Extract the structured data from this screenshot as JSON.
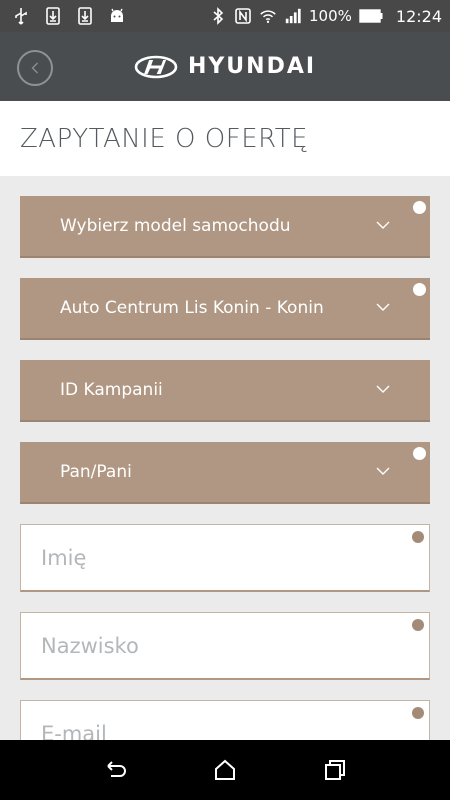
{
  "status_bar": {
    "battery": "100%",
    "time": "12:24",
    "icons": [
      "usb-icon",
      "download-icon",
      "download-icon",
      "android-icon",
      "bluetooth-icon",
      "nfc-icon",
      "wifi-icon",
      "signal-icon",
      "battery-icon"
    ]
  },
  "app_bar": {
    "brand": "HYUNDAI"
  },
  "page": {
    "title": "ZAPYTANIE O OFERTĘ"
  },
  "form": {
    "model_select": "Wybierz model samochodu",
    "dealer_select": "Auto Centrum Lis Konin - Konin",
    "campaign_select": "ID Kampanii",
    "salutation_select": "Pan/Pani",
    "first_name_placeholder": "Imię",
    "last_name_placeholder": "Nazwisko",
    "email_placeholder": "E-mail"
  },
  "colors": {
    "field_brown": "#af9783",
    "app_bar": "#4a4d4f"
  }
}
